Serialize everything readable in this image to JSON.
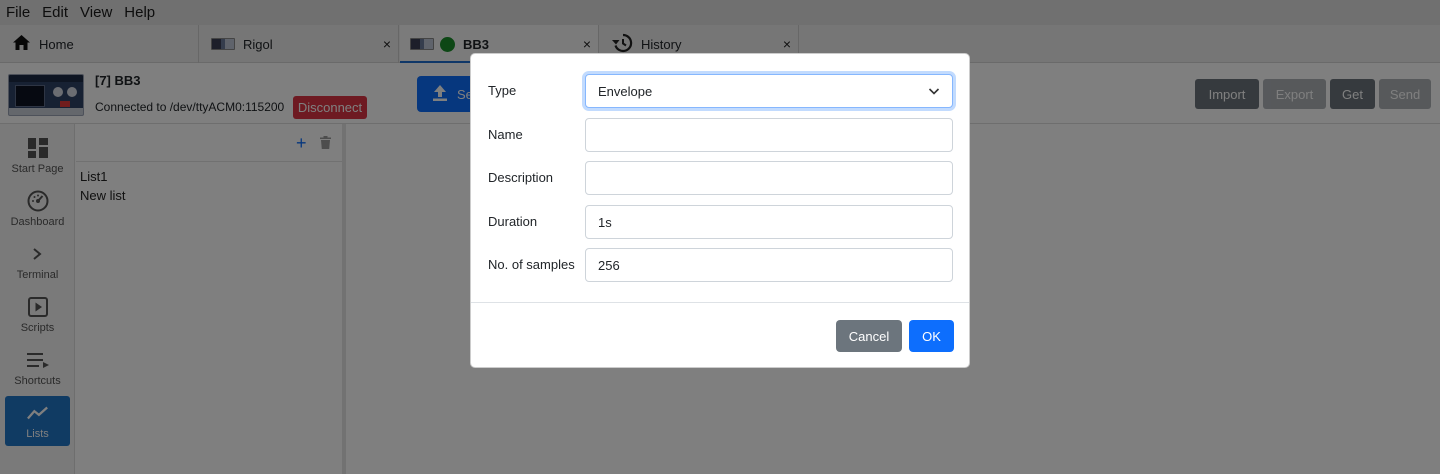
{
  "menubar": {
    "items": [
      "File",
      "Edit",
      "View",
      "Help"
    ]
  },
  "tabs": [
    {
      "label": "Home",
      "icon": "home-icon"
    },
    {
      "label": "Rigol",
      "icon": "instrument-thumbnail-icon"
    },
    {
      "label": "BB3",
      "icon": "instrument-thumbnail-icon",
      "status_color": "#1a8f2a"
    },
    {
      "label": "History",
      "icon": "history-icon"
    }
  ],
  "tab_close_glyph": "×",
  "instrument": {
    "title": "[7] BB3",
    "connection": "Connected to /dev/ttyACM0:115200",
    "disconnect_label": "Disconnect",
    "send_file_label": "Se"
  },
  "toolbar": {
    "import_label": "Import",
    "export_label": "Export",
    "get_label": "Get",
    "send_label": "Send"
  },
  "sidebar": {
    "items": [
      {
        "label": "Start Page",
        "icon": "start-page-icon"
      },
      {
        "label": "Dashboard",
        "icon": "dashboard-icon"
      },
      {
        "label": "Terminal",
        "icon": "terminal-icon"
      },
      {
        "label": "Scripts",
        "icon": "scripts-icon"
      },
      {
        "label": "Shortcuts",
        "icon": "shortcuts-icon"
      },
      {
        "label": "Lists",
        "icon": "lists-icon",
        "active": true
      }
    ]
  },
  "lists": {
    "add_glyph": "+",
    "items": [
      "List1",
      "New list"
    ]
  },
  "dialog": {
    "type_label": "Type",
    "type_value": "Envelope",
    "name_label": "Name",
    "name_value": "",
    "description_label": "Description",
    "description_value": "",
    "duration_label": "Duration",
    "duration_value": "1s",
    "samples_label": "No. of samples",
    "samples_value": "256",
    "cancel_label": "Cancel",
    "ok_label": "OK"
  },
  "colors": {
    "primary": "#0d6efd",
    "danger": "#dc3545",
    "secondary": "#6c757d",
    "sidebar_active": "#2176c7"
  }
}
